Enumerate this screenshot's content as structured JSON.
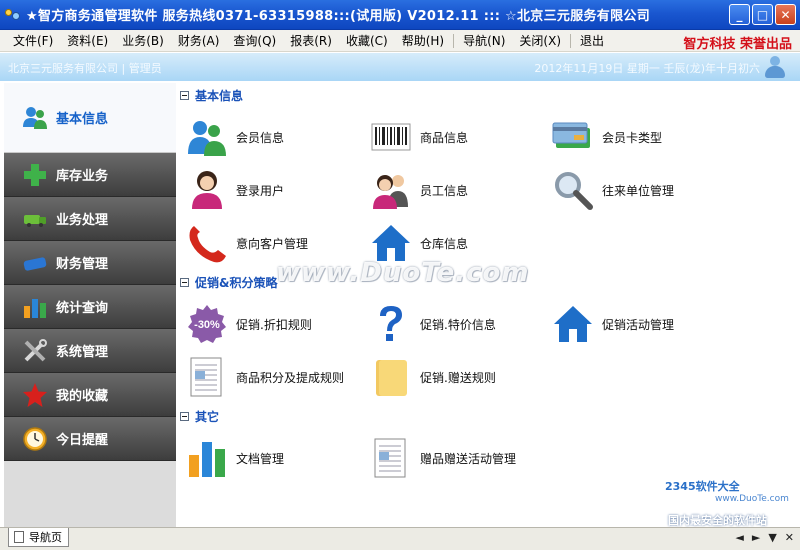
{
  "window": {
    "title": "★智方商务通管理软件 服务热线0371-63315988:::(试用版) V2012.11 ::: ☆北京三元服务有限公司",
    "minimize_label": "_",
    "maximize_label": "□",
    "close_label": "✕"
  },
  "menu": {
    "items": [
      "文件(F)",
      "资料(E)",
      "业务(B)",
      "财务(A)",
      "查询(Q)",
      "报表(R)",
      "收藏(C)",
      "帮助(H)",
      "导航(N)",
      "关闭(X)",
      "退出"
    ],
    "brand": "智方科技 荣誉出品"
  },
  "infobar": {
    "company_user": "北京三元服务有限公司 | 管理员",
    "date": "2012年11月19日 星期一 壬辰(龙)年十月初六"
  },
  "sidebar": {
    "items": [
      {
        "label": "基本信息",
        "icon": "users-icon"
      },
      {
        "label": "库存业务",
        "icon": "plus-icon"
      },
      {
        "label": "业务处理",
        "icon": "truck-icon"
      },
      {
        "label": "财务管理",
        "icon": "card-icon"
      },
      {
        "label": "统计查询",
        "icon": "chart-icon"
      },
      {
        "label": "系统管理",
        "icon": "tools-icon"
      },
      {
        "label": "我的收藏",
        "icon": "star-icon"
      },
      {
        "label": "今日提醒",
        "icon": "clock-icon"
      }
    ]
  },
  "sections": {
    "basic": {
      "title": "基本信息",
      "tiles": [
        "会员信息",
        "商品信息",
        "会员卡类型",
        "登录用户",
        "员工信息",
        "往来单位管理",
        "意向客户管理",
        "仓库信息"
      ]
    },
    "promo": {
      "title": "促销&积分策略",
      "tiles": [
        "促销.折扣规则",
        "促销.特价信息",
        "促销活动管理",
        "商品积分及提成规则",
        "促销.赠送规则"
      ],
      "discount_badge": "-30%"
    },
    "other": {
      "title": "其它",
      "tiles": [
        "文档管理",
        "赠品赠送活动管理"
      ]
    }
  },
  "watermarks": {
    "duote": "www.DuoTe.com",
    "site2345": "2345软件大全",
    "site2345_url": "www.DuoTe.com",
    "slogan": "国内最安全的软件站"
  },
  "statusbar": {
    "nav_tab": "导航页",
    "prev": "◄",
    "next": "►",
    "down": "▼",
    "close": "✕"
  },
  "colors": {
    "title_blue": "#1a57d0",
    "brand_red": "#d4101a",
    "section_blue": "#1a52b8",
    "sidebar_dark": "#4a4a4a"
  }
}
